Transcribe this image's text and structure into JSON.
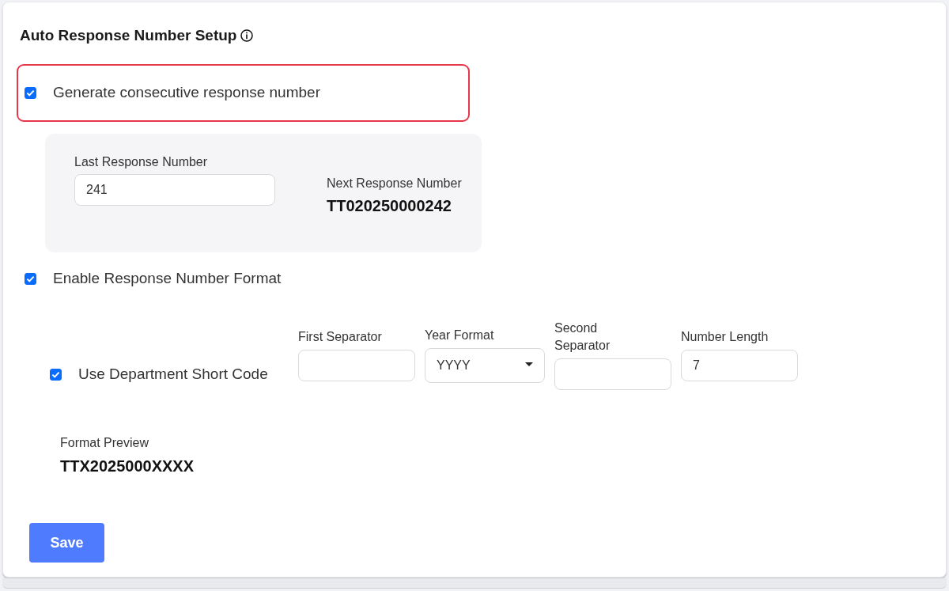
{
  "section": {
    "title": "Auto Response Number Setup"
  },
  "consecutive": {
    "label": "Generate consecutive response number",
    "checked": true,
    "highlighted": true,
    "last_number": {
      "label": "Last Response Number",
      "value": "241"
    },
    "next_number": {
      "label": "Next Response Number",
      "value": "TT020250000242"
    }
  },
  "format": {
    "label": "Enable Response Number Format",
    "checked": true,
    "department_code": {
      "label": "Use Department Short Code",
      "checked": true
    },
    "fields": [
      {
        "kind": "input",
        "label": "First Separator"
      },
      {
        "kind": "select",
        "label": "Year Format",
        "value": "YYYY"
      },
      {
        "kind": "input",
        "label": "Second Separator"
      },
      {
        "kind": "input",
        "label": "Number Length",
        "value": "7"
      }
    ],
    "preview": {
      "label": "Format Preview",
      "value": "TTX2025000XXXX"
    }
  },
  "buttons": [
    {
      "label": "Save"
    }
  ]
}
